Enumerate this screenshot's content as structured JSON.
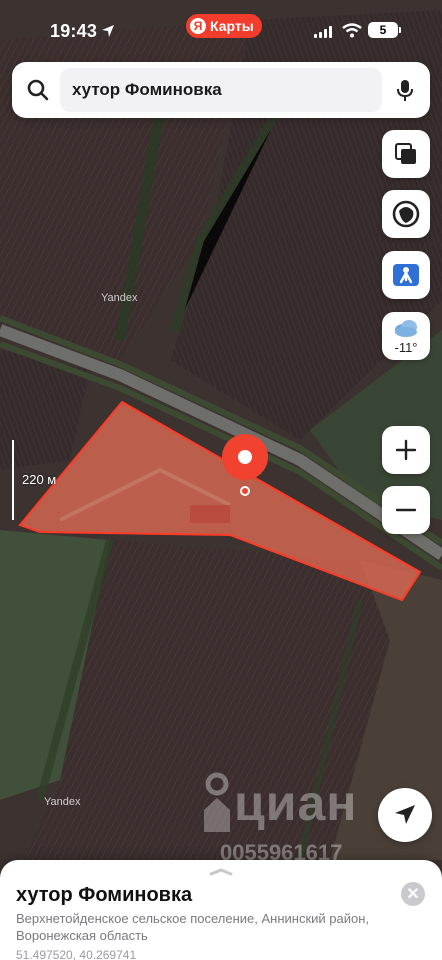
{
  "status_bar": {
    "time": "19:43",
    "app_badge_logo": "Я",
    "app_badge_label": "Карты",
    "battery": "5"
  },
  "search": {
    "query": "хутор Фоминовка"
  },
  "map": {
    "weather_temp": "-11°",
    "scale_label": "220 м",
    "watermark_provider": "Yandex",
    "watermark_listing": "циан",
    "watermark_phone": "0055961617",
    "accent_color": "#f0422e",
    "plot_fill_color": "#e06a54"
  },
  "icons": {
    "search": "search-icon",
    "mic": "microphone-icon",
    "layers": "layers-icon",
    "route": "route-icon",
    "pedestrian": "panorama-icon",
    "weather": "cloud-icon",
    "zoom_in": "plus-icon",
    "zoom_out": "minus-icon",
    "locate": "navigation-arrow-icon",
    "close": "close-icon"
  },
  "place_card": {
    "title": "хутор Фоминовка",
    "address": "Верхнетойденское сельское поселение, Аннинский район, Воронежская область",
    "coordinates": "51.497520, 40.269741"
  }
}
